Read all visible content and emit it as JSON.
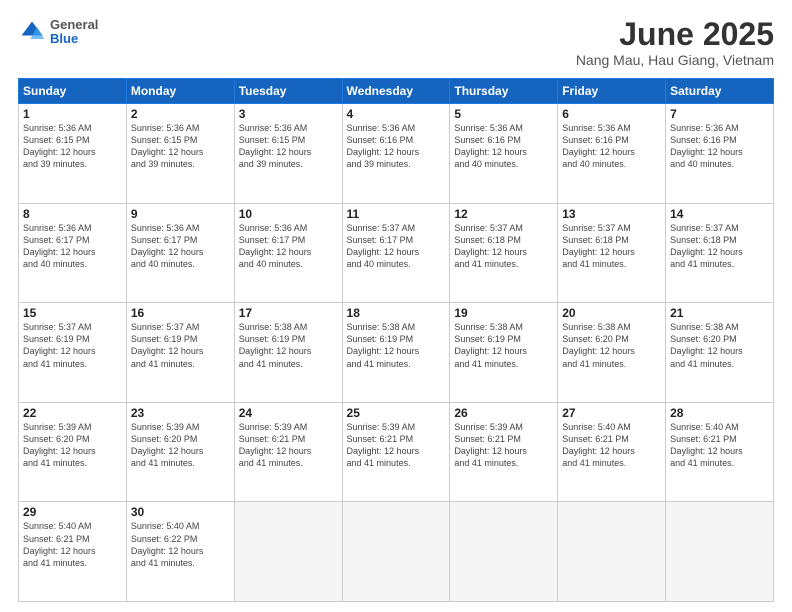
{
  "header": {
    "logo": {
      "general": "General",
      "blue": "Blue"
    },
    "title": "June 2025",
    "subtitle": "Nang Mau, Hau Giang, Vietnam"
  },
  "weekdays": [
    "Sunday",
    "Monday",
    "Tuesday",
    "Wednesday",
    "Thursday",
    "Friday",
    "Saturday"
  ],
  "weeks": [
    [
      {
        "day": "1",
        "info": "Sunrise: 5:36 AM\nSunset: 6:15 PM\nDaylight: 12 hours\nand 39 minutes."
      },
      {
        "day": "2",
        "info": "Sunrise: 5:36 AM\nSunset: 6:15 PM\nDaylight: 12 hours\nand 39 minutes."
      },
      {
        "day": "3",
        "info": "Sunrise: 5:36 AM\nSunset: 6:15 PM\nDaylight: 12 hours\nand 39 minutes."
      },
      {
        "day": "4",
        "info": "Sunrise: 5:36 AM\nSunset: 6:16 PM\nDaylight: 12 hours\nand 39 minutes."
      },
      {
        "day": "5",
        "info": "Sunrise: 5:36 AM\nSunset: 6:16 PM\nDaylight: 12 hours\nand 40 minutes."
      },
      {
        "day": "6",
        "info": "Sunrise: 5:36 AM\nSunset: 6:16 PM\nDaylight: 12 hours\nand 40 minutes."
      },
      {
        "day": "7",
        "info": "Sunrise: 5:36 AM\nSunset: 6:16 PM\nDaylight: 12 hours\nand 40 minutes."
      }
    ],
    [
      {
        "day": "8",
        "info": "Sunrise: 5:36 AM\nSunset: 6:17 PM\nDaylight: 12 hours\nand 40 minutes."
      },
      {
        "day": "9",
        "info": "Sunrise: 5:36 AM\nSunset: 6:17 PM\nDaylight: 12 hours\nand 40 minutes."
      },
      {
        "day": "10",
        "info": "Sunrise: 5:36 AM\nSunset: 6:17 PM\nDaylight: 12 hours\nand 40 minutes."
      },
      {
        "day": "11",
        "info": "Sunrise: 5:37 AM\nSunset: 6:17 PM\nDaylight: 12 hours\nand 40 minutes."
      },
      {
        "day": "12",
        "info": "Sunrise: 5:37 AM\nSunset: 6:18 PM\nDaylight: 12 hours\nand 41 minutes."
      },
      {
        "day": "13",
        "info": "Sunrise: 5:37 AM\nSunset: 6:18 PM\nDaylight: 12 hours\nand 41 minutes."
      },
      {
        "day": "14",
        "info": "Sunrise: 5:37 AM\nSunset: 6:18 PM\nDaylight: 12 hours\nand 41 minutes."
      }
    ],
    [
      {
        "day": "15",
        "info": "Sunrise: 5:37 AM\nSunset: 6:19 PM\nDaylight: 12 hours\nand 41 minutes."
      },
      {
        "day": "16",
        "info": "Sunrise: 5:37 AM\nSunset: 6:19 PM\nDaylight: 12 hours\nand 41 minutes."
      },
      {
        "day": "17",
        "info": "Sunrise: 5:38 AM\nSunset: 6:19 PM\nDaylight: 12 hours\nand 41 minutes."
      },
      {
        "day": "18",
        "info": "Sunrise: 5:38 AM\nSunset: 6:19 PM\nDaylight: 12 hours\nand 41 minutes."
      },
      {
        "day": "19",
        "info": "Sunrise: 5:38 AM\nSunset: 6:19 PM\nDaylight: 12 hours\nand 41 minutes."
      },
      {
        "day": "20",
        "info": "Sunrise: 5:38 AM\nSunset: 6:20 PM\nDaylight: 12 hours\nand 41 minutes."
      },
      {
        "day": "21",
        "info": "Sunrise: 5:38 AM\nSunset: 6:20 PM\nDaylight: 12 hours\nand 41 minutes."
      }
    ],
    [
      {
        "day": "22",
        "info": "Sunrise: 5:39 AM\nSunset: 6:20 PM\nDaylight: 12 hours\nand 41 minutes."
      },
      {
        "day": "23",
        "info": "Sunrise: 5:39 AM\nSunset: 6:20 PM\nDaylight: 12 hours\nand 41 minutes."
      },
      {
        "day": "24",
        "info": "Sunrise: 5:39 AM\nSunset: 6:21 PM\nDaylight: 12 hours\nand 41 minutes."
      },
      {
        "day": "25",
        "info": "Sunrise: 5:39 AM\nSunset: 6:21 PM\nDaylight: 12 hours\nand 41 minutes."
      },
      {
        "day": "26",
        "info": "Sunrise: 5:39 AM\nSunset: 6:21 PM\nDaylight: 12 hours\nand 41 minutes."
      },
      {
        "day": "27",
        "info": "Sunrise: 5:40 AM\nSunset: 6:21 PM\nDaylight: 12 hours\nand 41 minutes."
      },
      {
        "day": "28",
        "info": "Sunrise: 5:40 AM\nSunset: 6:21 PM\nDaylight: 12 hours\nand 41 minutes."
      }
    ],
    [
      {
        "day": "29",
        "info": "Sunrise: 5:40 AM\nSunset: 6:21 PM\nDaylight: 12 hours\nand 41 minutes."
      },
      {
        "day": "30",
        "info": "Sunrise: 5:40 AM\nSunset: 6:22 PM\nDaylight: 12 hours\nand 41 minutes."
      },
      {
        "day": "",
        "info": ""
      },
      {
        "day": "",
        "info": ""
      },
      {
        "day": "",
        "info": ""
      },
      {
        "day": "",
        "info": ""
      },
      {
        "day": "",
        "info": ""
      }
    ]
  ]
}
